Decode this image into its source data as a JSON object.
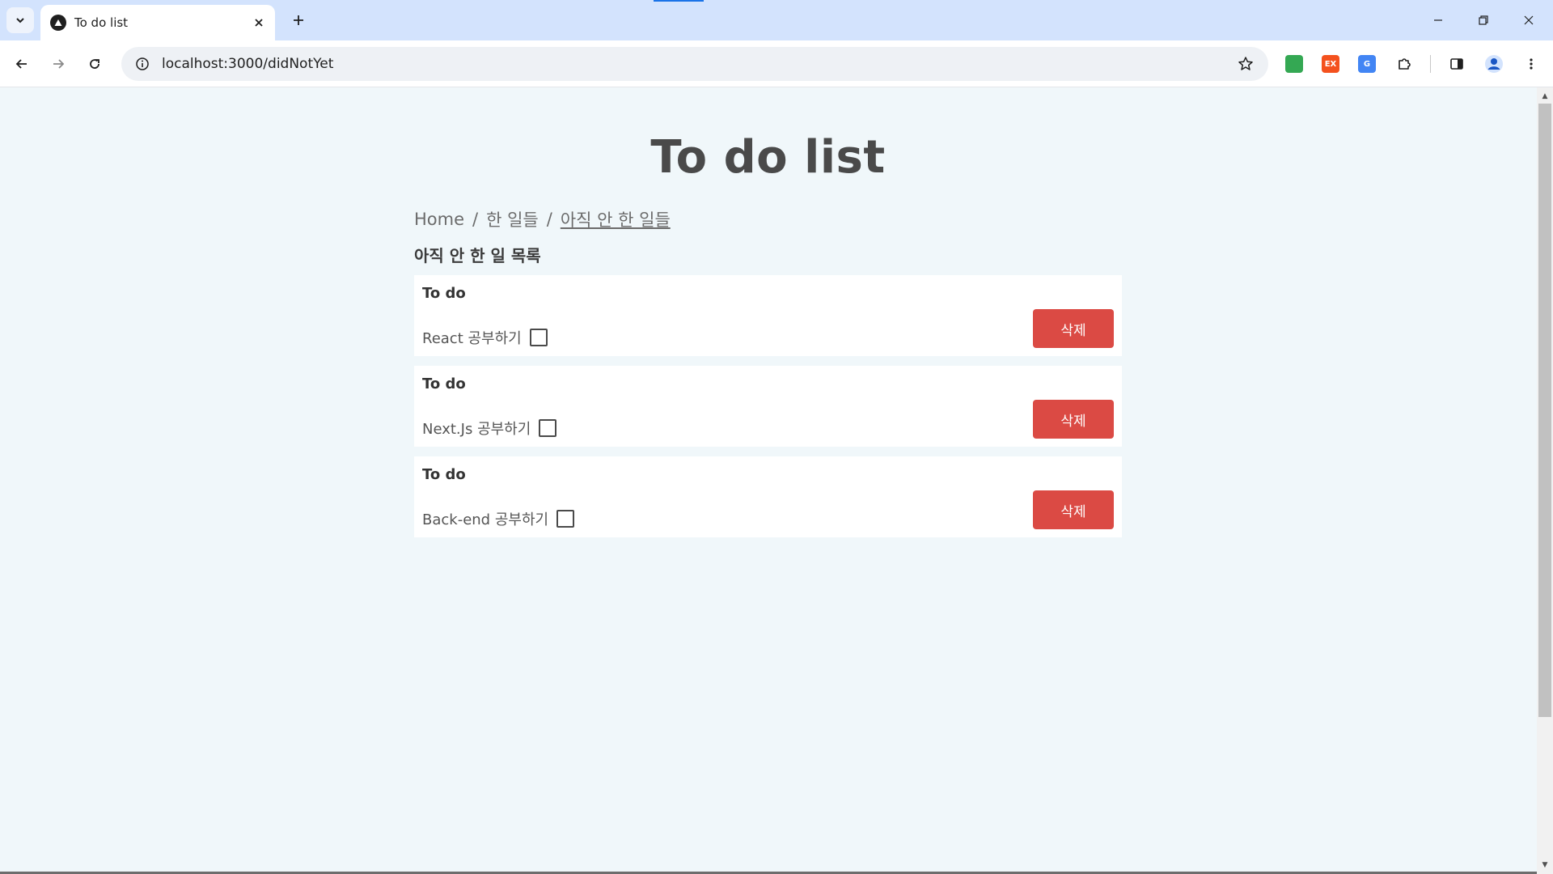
{
  "browser": {
    "tab_title": "To do list",
    "url": "localhost:3000/didNotYet",
    "extensions": [
      {
        "name": "green-extension-icon",
        "color": "#34a853",
        "label": ""
      },
      {
        "name": "ex-extension-icon",
        "color": "#f4511e",
        "label": "EX"
      },
      {
        "name": "translate-extension-icon",
        "color": "#4285f4",
        "label": "G"
      }
    ]
  },
  "page": {
    "title": "To do list",
    "breadcrumb": {
      "home": "Home",
      "separator": "/",
      "done": "한 일들",
      "not_yet": "아직 안 한 일들"
    },
    "section_heading": "아직 안 한 일 목록",
    "todos": [
      {
        "label": "To do",
        "text": "React 공부하기",
        "checked": false,
        "delete_label": "삭제"
      },
      {
        "label": "To do",
        "text": "Next.Js 공부하기",
        "checked": false,
        "delete_label": "삭제"
      },
      {
        "label": "To do",
        "text": "Back-end 공부하기",
        "checked": false,
        "delete_label": "삭제"
      }
    ]
  },
  "colors": {
    "page_background": "#f0f7fa",
    "delete_button": "#db4a44",
    "tabstrip": "#d3e3fd"
  }
}
